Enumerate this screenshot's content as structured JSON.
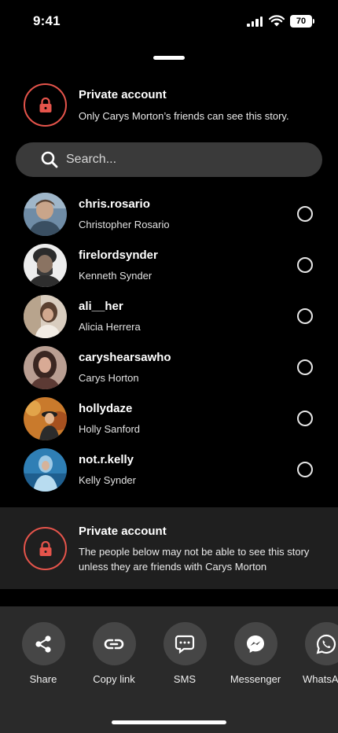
{
  "status_bar": {
    "time": "9:41",
    "battery": "70"
  },
  "privacy_notice": {
    "title": "Private account",
    "description": "Only Carys Morton’s friends can see this story."
  },
  "search": {
    "placeholder": "Search..."
  },
  "friends": [
    {
      "username": "chris.rosario",
      "name": "Christopher Rosario"
    },
    {
      "username": "firelordsynder",
      "name": "Kenneth Synder"
    },
    {
      "username": "ali__her",
      "name": "Alicia Herrera"
    },
    {
      "username": "caryshearsawho",
      "name": "Carys Horton"
    },
    {
      "username": "hollydaze",
      "name": "Holly Sanford"
    },
    {
      "username": "not.r.kelly",
      "name": "Kelly Synder"
    }
  ],
  "private_panel": {
    "title": "Private account",
    "description": "The people below may not be able to see this story unless they are friends with Carys Morton"
  },
  "share_options": [
    {
      "label": "Share",
      "icon": "share-icon"
    },
    {
      "label": "Copy link",
      "icon": "link-icon"
    },
    {
      "label": "SMS",
      "icon": "sms-icon"
    },
    {
      "label": "Messenger",
      "icon": "messenger-icon"
    },
    {
      "label": "WhatsApp",
      "icon": "whatsapp-icon"
    }
  ],
  "colors": {
    "accent_lock": "#e5544b",
    "background": "#000000",
    "panel": "#1f1f1f",
    "share_sheet": "#2a2a2a"
  }
}
